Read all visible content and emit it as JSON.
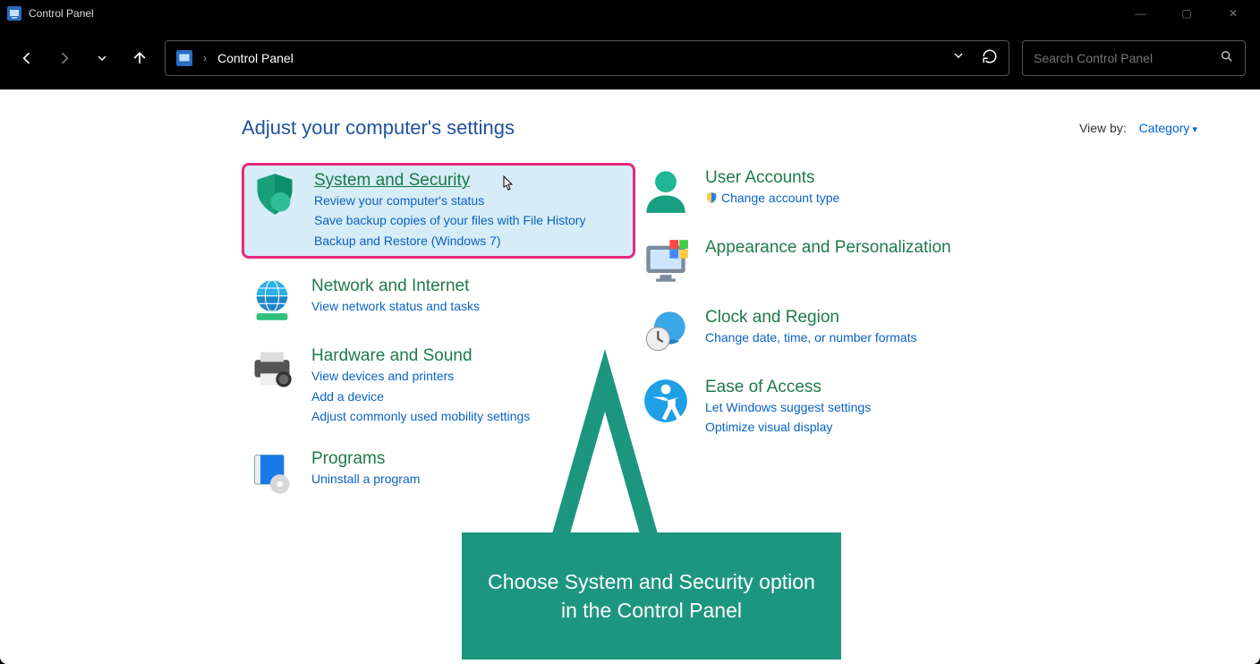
{
  "window": {
    "title": "Control Panel"
  },
  "breadcrumb": {
    "root": "Control Panel"
  },
  "search": {
    "placeholder": "Search Control Panel"
  },
  "header": {
    "title": "Adjust your computer's settings"
  },
  "viewby": {
    "label": "View by:",
    "value": "Category"
  },
  "left": [
    {
      "key": "system_security",
      "title": "System and Security",
      "links": [
        "Review your computer's status",
        "Save backup copies of your files with File History",
        "Backup and Restore (Windows 7)"
      ],
      "highlighted": true
    },
    {
      "key": "network",
      "title": "Network and Internet",
      "links": [
        "View network status and tasks"
      ]
    },
    {
      "key": "hardware",
      "title": "Hardware and Sound",
      "links": [
        "View devices and printers",
        "Add a device",
        "Adjust commonly used mobility settings"
      ]
    },
    {
      "key": "programs",
      "title": "Programs",
      "links": [
        "Uninstall a program"
      ]
    }
  ],
  "right": [
    {
      "key": "users",
      "title": "User Accounts",
      "links_shielded": [
        "Change account type"
      ]
    },
    {
      "key": "appearance",
      "title": "Appearance and Personalization",
      "links": []
    },
    {
      "key": "clock",
      "title": "Clock and Region",
      "links": [
        "Change date, time, or number formats"
      ]
    },
    {
      "key": "ease",
      "title": "Ease of Access",
      "links": [
        "Let Windows suggest settings",
        "Optimize visual display"
      ]
    }
  ],
  "callout": {
    "text": "Choose System and Security option in the Control Panel"
  }
}
